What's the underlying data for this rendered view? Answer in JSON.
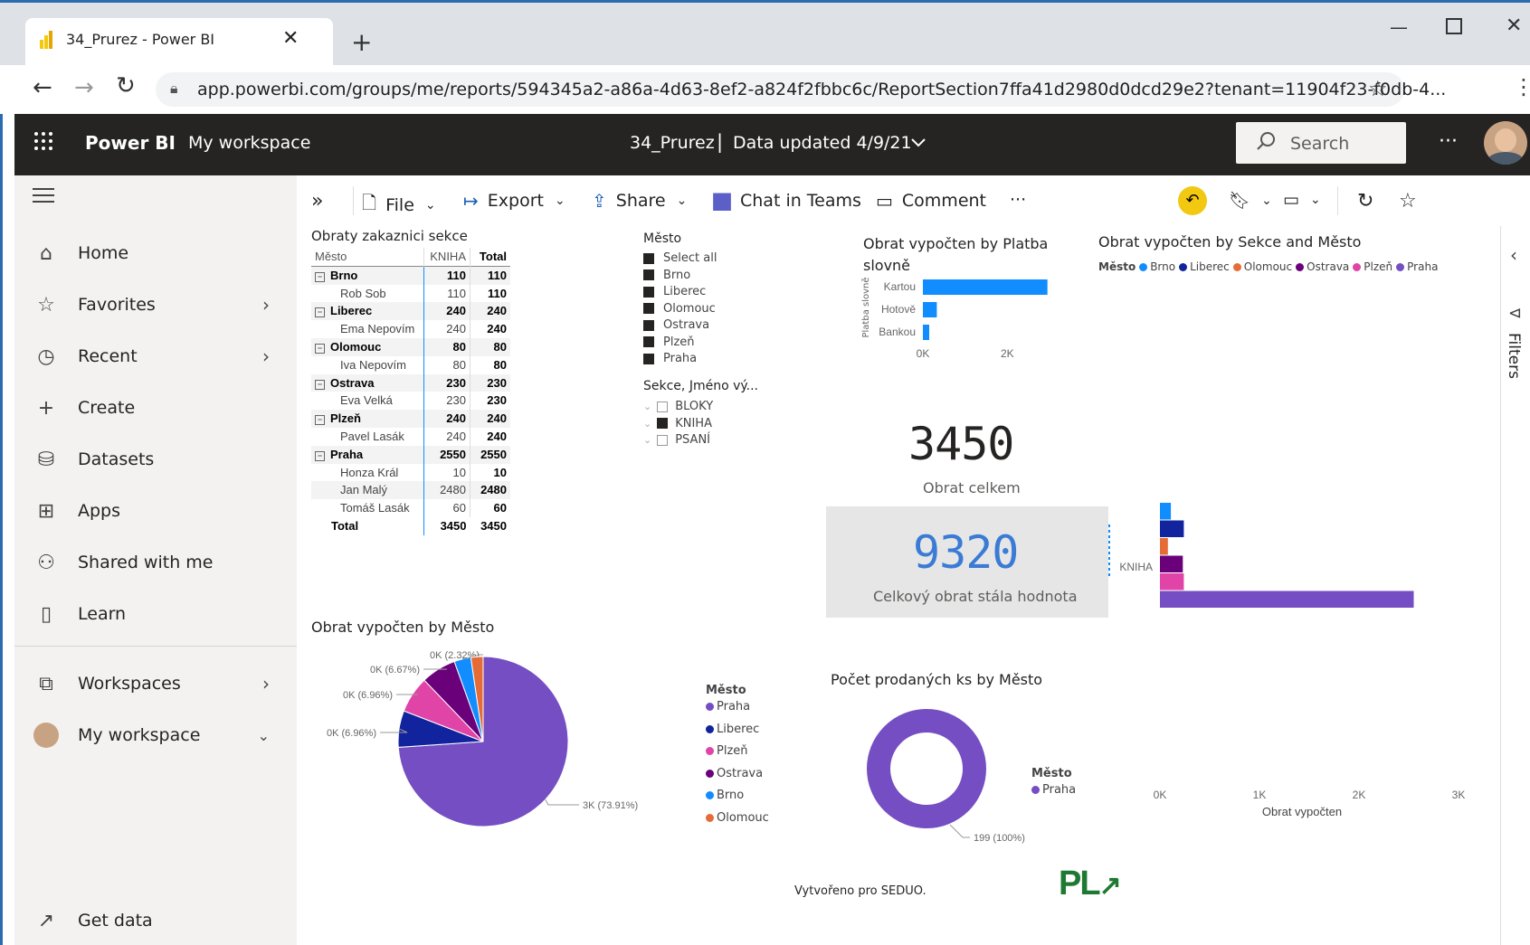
{
  "browser": {
    "tab_title": "34_Prurez - Power BI",
    "url": "app.powerbi.com/groups/me/reports/594345a2-a86a-4d63-8ef2-a824f2fbbc6c/ReportSection7ffa41d2980d0dcd29e2?tenant=11904f23-f0db-4..."
  },
  "header": {
    "brand": "Power BI",
    "workspace": "My workspace",
    "report_name": "34_Prurez",
    "separator": "|",
    "updated": "Data updated 4/9/21",
    "search_placeholder": "Search",
    "more": "···"
  },
  "nav": {
    "items": [
      {
        "label": "Home",
        "icon": "home-icon"
      },
      {
        "label": "Favorites",
        "icon": "star-icon"
      },
      {
        "label": "Recent",
        "icon": "clock-icon"
      },
      {
        "label": "Create",
        "icon": "plus-icon"
      },
      {
        "label": "Datasets",
        "icon": "database-icon"
      },
      {
        "label": "Apps",
        "icon": "apps-icon"
      },
      {
        "label": "Shared with me",
        "icon": "shared-icon"
      },
      {
        "label": "Learn",
        "icon": "book-icon"
      },
      {
        "label": "Workspaces",
        "icon": "workspaces-icon"
      },
      {
        "label": "My workspace",
        "icon": "avatar"
      },
      {
        "label": "Get data",
        "icon": "arrow-up-right-icon"
      }
    ]
  },
  "toolbar": {
    "file": "File",
    "export": "Export",
    "share": "Share",
    "chat": "Chat in Teams",
    "comment": "Comment",
    "more": "···"
  },
  "side_panel": {
    "filters": "Filters"
  },
  "matrix": {
    "title": "Obraty zakaznici sekce",
    "headers": [
      "Město",
      "KNIHA",
      "Total"
    ],
    "rows": [
      {
        "label": "Brno",
        "kniha": "110",
        "total": "110",
        "level": 0
      },
      {
        "label": "Rob Sob",
        "kniha": "110",
        "total": "110",
        "level": 1
      },
      {
        "label": "Liberec",
        "kniha": "240",
        "total": "240",
        "level": 0
      },
      {
        "label": "Ema Nepovím",
        "kniha": "240",
        "total": "240",
        "level": 1
      },
      {
        "label": "Olomouc",
        "kniha": "80",
        "total": "80",
        "level": 0
      },
      {
        "label": "Iva Nepovím",
        "kniha": "80",
        "total": "80",
        "level": 1
      },
      {
        "label": "Ostrava",
        "kniha": "230",
        "total": "230",
        "level": 0
      },
      {
        "label": "Eva Velká",
        "kniha": "230",
        "total": "230",
        "level": 1
      },
      {
        "label": "Plzeň",
        "kniha": "240",
        "total": "240",
        "level": 0
      },
      {
        "label": "Pavel Lasák",
        "kniha": "240",
        "total": "240",
        "level": 1
      },
      {
        "label": "Praha",
        "kniha": "2550",
        "total": "2550",
        "level": 0
      },
      {
        "label": "Honza Král",
        "kniha": "10",
        "total": "10",
        "level": 1
      },
      {
        "label": "Jan Malý",
        "kniha": "2480",
        "total": "2480",
        "level": 1
      },
      {
        "label": "Tomáš Lasák",
        "kniha": "60",
        "total": "60",
        "level": 1
      }
    ],
    "total": {
      "label": "Total",
      "kniha": "3450",
      "total": "3450"
    }
  },
  "slicer_city": {
    "title": "Město",
    "items": [
      "Select all",
      "Brno",
      "Liberec",
      "Olomouc",
      "Ostrava",
      "Plzeň",
      "Praha"
    ]
  },
  "slicer_sekce": {
    "title": "Sekce, Jméno vý...",
    "items": [
      {
        "label": "BLOKY",
        "checked": false
      },
      {
        "label": "KNIHA",
        "checked": true
      },
      {
        "label": "PSANÍ",
        "checked": false
      }
    ]
  },
  "card1": {
    "value": "3450",
    "label": "Obrat celkem"
  },
  "card2": {
    "value": "9320",
    "label": "Celkový obrat stála hodnota"
  },
  "footer": {
    "created": "Vytvořeno pro SEDUO.",
    "logo": "PL"
  },
  "colors": {
    "Praha": "#744ec2",
    "Liberec": "#12239e",
    "Plzeň": "#e044a7",
    "Ostrava": "#6b007b",
    "Brno": "#118dff",
    "Olomouc": "#e66c37",
    "bar": "#118dff"
  },
  "chart_data": [
    {
      "type": "bar",
      "title": "Obrat vypočten by Platba slovně",
      "ylabel": "Platba slovně",
      "categories": [
        "Kartou",
        "Hotově",
        "Bankou"
      ],
      "values": [
        2950,
        330,
        150
      ],
      "xlim": [
        0,
        3000
      ],
      "tick_labels": [
        "0K",
        "2K"
      ],
      "tick_values": [
        0,
        2000
      ]
    },
    {
      "type": "bar",
      "title": "Obrat vypočten by Sekce and Město",
      "legend_title": "Město",
      "xlabel": "Obrat vypočten",
      "categories": [
        "KNIHA"
      ],
      "series": [
        {
          "name": "Brno",
          "values": [
            110
          ]
        },
        {
          "name": "Liberec",
          "values": [
            240
          ]
        },
        {
          "name": "Olomouc",
          "values": [
            80
          ]
        },
        {
          "name": "Ostrava",
          "values": [
            230
          ]
        },
        {
          "name": "Plzeň",
          "values": [
            240
          ]
        },
        {
          "name": "Praha",
          "values": [
            2550
          ]
        }
      ],
      "xlim": [
        0,
        3000
      ],
      "tick_labels": [
        "0K",
        "1K",
        "2K",
        "3K"
      ],
      "tick_values": [
        0,
        1000,
        2000,
        3000
      ]
    },
    {
      "type": "pie",
      "title": "Obrat vypočten by Město",
      "legend_title": "Město",
      "slices": [
        {
          "name": "Praha",
          "value": 2550,
          "label": "3K (73.91%)"
        },
        {
          "name": "Liberec",
          "value": 240,
          "label": "0K (6.96%)"
        },
        {
          "name": "Plzeň",
          "value": 240,
          "label": "0K (6.96%)"
        },
        {
          "name": "Ostrava",
          "value": 230,
          "label": "0K (6.67%)"
        },
        {
          "name": "Brno",
          "value": 110,
          "label": "0K (2.32%)"
        },
        {
          "name": "Olomouc",
          "value": 80,
          "label": ""
        }
      ]
    },
    {
      "type": "pie",
      "title": "Počet prodaných ks by Město",
      "legend_title": "Město",
      "slices": [
        {
          "name": "Praha",
          "value": 199,
          "label": "199 (100%)"
        }
      ]
    }
  ]
}
